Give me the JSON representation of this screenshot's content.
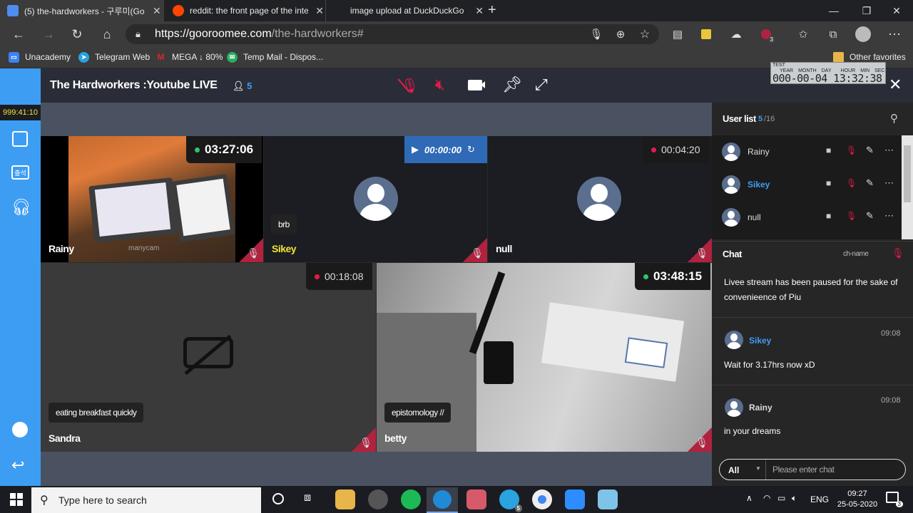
{
  "browser": {
    "tabs": [
      {
        "title": "(5) the-hardworkers - 구루미(Go",
        "close": "✕",
        "color": "#4d8ef0"
      },
      {
        "title": "reddit: the front page of the inte",
        "close": "✕",
        "color": "#ff4500"
      },
      {
        "title": "image upload at DuckDuckGo",
        "close": "✕",
        "color": "#de5833"
      }
    ],
    "new_tab": "+",
    "url_host": "https://gooroomee.com",
    "url_path": "/the-hardworkers#",
    "bookmarks": [
      {
        "label": "Unacademy",
        "color": "#3b82f6",
        "glyph": "▭"
      },
      {
        "label": "Telegram Web",
        "color": "#2aa3e0",
        "glyph": "➤"
      },
      {
        "label": "MEGA ↓ 80%",
        "color": "#d9272e",
        "glyph": "M"
      },
      {
        "label": "Temp Mail - Dispos...",
        "color": "#27ae60",
        "glyph": "✉"
      }
    ],
    "other_favorites": "Other favorites",
    "ext_badge": "3"
  },
  "app": {
    "room_title": "The Hardworkers :Youtube LIVE",
    "participant_count": "5",
    "clock": {
      "test_label": "TEST",
      "labels": [
        "YEAR",
        "MONTH",
        "DAY",
        "HOUR",
        "MIN",
        "SEC"
      ],
      "value": "000-00-04 13:32:38"
    },
    "rail_timer": "999:41:10",
    "rail_attend": "출석"
  },
  "tiles": [
    {
      "name": "Rainy",
      "timer": "03:27:06",
      "timer_dot": "#33c46b",
      "name_color": "#ffffff"
    },
    {
      "name": "Sikey",
      "status": "brb",
      "player_time": "00:00:00",
      "name_color": "#f2e23a"
    },
    {
      "name": "null",
      "timer": "00:04:20",
      "timer_dot": "#e8194a",
      "name_color": "#ffffff"
    },
    {
      "name": "Sandra",
      "timer": "00:18:08",
      "timer_dot": "#e8194a",
      "status": "eating breakfast quickly",
      "name_color": "#ffffff"
    },
    {
      "name": "betty",
      "timer": "03:48:15",
      "timer_dot": "#33c46b",
      "status": "epistomology //",
      "name_color": "#ffffff"
    }
  ],
  "tile_watermark": "manycam",
  "userlist": {
    "title": "User list",
    "count": "5",
    "total": "/16",
    "users": [
      {
        "name": "Rainy",
        "color": "#dddddd"
      },
      {
        "name": "Sikey",
        "color": "#3d9df3"
      },
      {
        "name": "null",
        "color": "#dddddd"
      }
    ]
  },
  "chat": {
    "title": "Chat",
    "chname": "ch-name",
    "notice": "Livee stream has been paused for the sake of convenieence of Piu",
    "messages": [
      {
        "user": "Sikey",
        "time": "09:08",
        "text": "Wait for 3.17hrs now xD",
        "user_color": "#3d9df3"
      },
      {
        "user": "Rainy",
        "time": "09:08",
        "text": "in your dreams",
        "user_color": "#dddddd"
      }
    ],
    "target": "All",
    "placeholder": "Please enter chat"
  },
  "taskbar": {
    "search_placeholder": "Type here to search",
    "lang": "ENG",
    "time": "09:27",
    "date": "25-05-2020",
    "telegram_badge": "5",
    "notif_badge": "3"
  }
}
